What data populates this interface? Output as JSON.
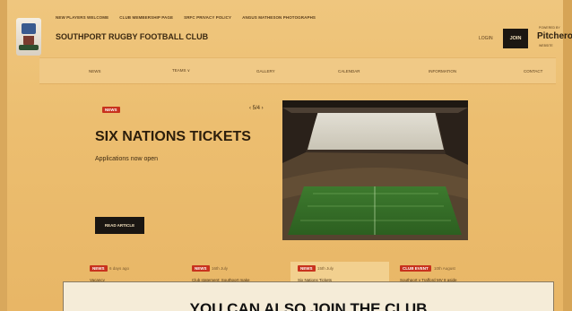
{
  "top_links": [
    "NEW PLAYERS WELCOME",
    "CLUB MEMBERSHIP PAGE",
    "SRFC PRIVACY POLICY",
    "ANGUS MATHESON PHOTOGRAPHS"
  ],
  "club_name": "SOUTHPORT RUGBY FOOTBALL CLUB",
  "header": {
    "login_label": "LOGIN",
    "join_label": "JOIN",
    "powered_by": "POWERED BY",
    "pitchero": "Pitchero",
    "pitchero_sub": "WEBSITE"
  },
  "nav": {
    "news": "NEWS",
    "teams": "TEAMS ∨",
    "gallery": "GALLERY",
    "calendar": "CALENDAR",
    "information": "INFORMATION",
    "contact": "CONTACT"
  },
  "hero": {
    "tag": "NEWS",
    "pager": "‹ 5/4 ›",
    "headline": "SIX NATIONS TICKETS",
    "subline": "Applications now open",
    "button": "READ ARTICLE"
  },
  "news_cards": [
    {
      "tag": "NEWS",
      "date": "6 days ago",
      "title": "Vacancy"
    },
    {
      "tag": "NEWS",
      "date": "16th July",
      "title": "Club statement: Southport make"
    },
    {
      "tag": "NEWS",
      "date": "15th July",
      "title": "Six Nations Tickets"
    },
    {
      "tag": "CLUB EVENT",
      "date": "10th August",
      "title": "Southport v Trafford MV 8 aside"
    }
  ],
  "banner": {
    "text": "YOU CAN ALSO JOIN THE CLUB"
  },
  "colors": {
    "accent_red": "#c8321e",
    "dark": "#1a1612",
    "overlay_tint": "#eab96b"
  }
}
